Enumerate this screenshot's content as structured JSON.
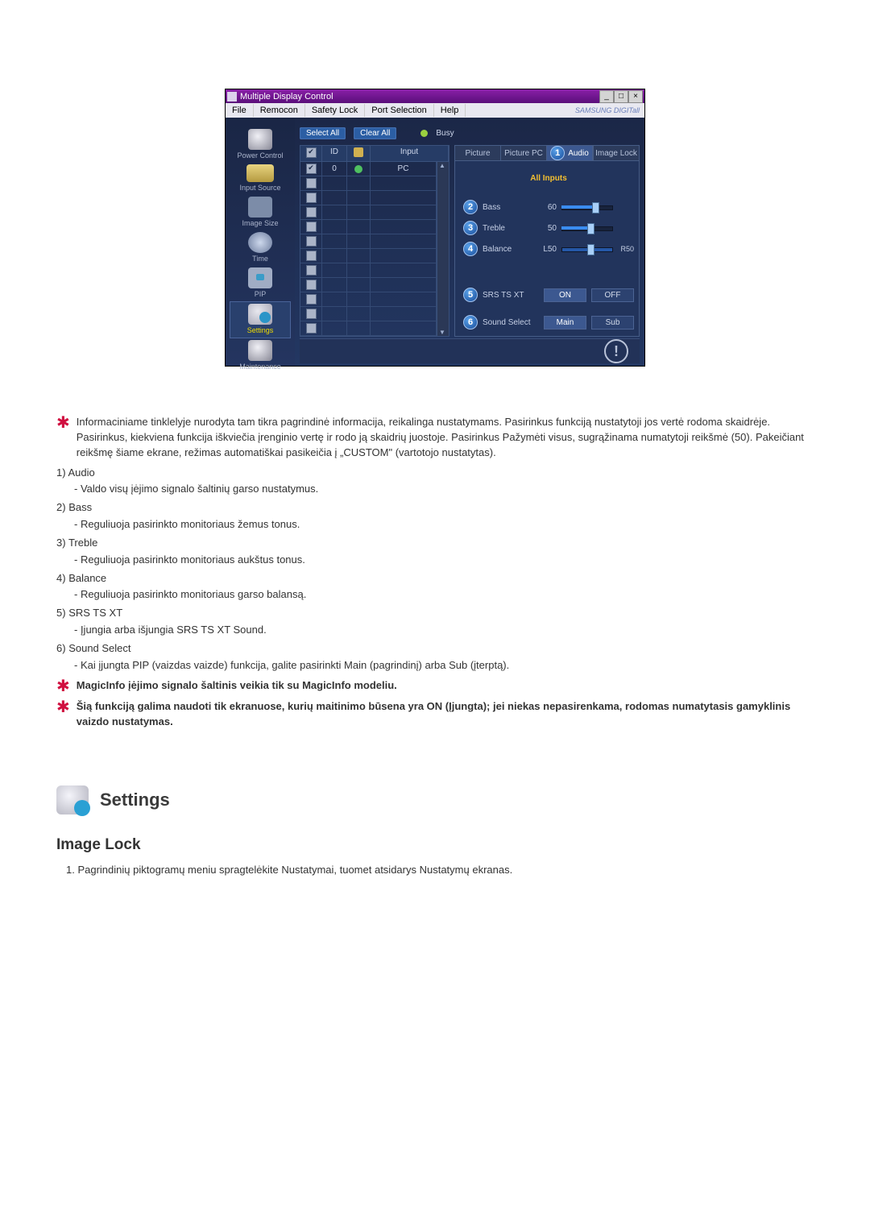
{
  "window": {
    "title": "Multiple Display Control",
    "menu": [
      "File",
      "Remocon",
      "Safety Lock",
      "Port Selection",
      "Help"
    ],
    "brand": "SAMSUNG DIGITall"
  },
  "sidebar": {
    "items": [
      {
        "label": "Power Control"
      },
      {
        "label": "Input Source"
      },
      {
        "label": "Image Size"
      },
      {
        "label": "Time"
      },
      {
        "label": "PIP"
      },
      {
        "label": "Settings"
      },
      {
        "label": "Maintenance"
      }
    ]
  },
  "controls": {
    "select_all": "Select All",
    "clear_all": "Clear All",
    "busy": "Busy"
  },
  "list": {
    "head": {
      "id": "ID",
      "input": "Input"
    },
    "row0": {
      "id": "0",
      "input": "PC"
    }
  },
  "tabs": {
    "picture": "Picture",
    "picture_pc": "Picture PC",
    "audio": "Audio",
    "image_lock": "Image Lock"
  },
  "badges": {
    "b1": "1",
    "b2": "2",
    "b3": "3",
    "b4": "4",
    "b5": "5",
    "b6": "6"
  },
  "panel": {
    "all_inputs": "All Inputs",
    "bass": {
      "label": "Bass",
      "value": "60"
    },
    "treble": {
      "label": "Treble",
      "value": "50"
    },
    "balance": {
      "label": "Balance",
      "value": "L50",
      "right": "R50"
    },
    "srs": {
      "label": "SRS TS XT",
      "on": "ON",
      "off": "OFF"
    },
    "sound_select": {
      "label": "Sound Select",
      "main": "Main",
      "sub": "Sub"
    }
  },
  "doc": {
    "intro": "Informaciniame tinklelyje nurodyta tam tikra pagrindinė informacija, reikalinga nustatymams. Pasirinkus funkciją nustatytoji jos vertė rodoma skaidrėje. Pasirinkus, kiekviena funkcija iškviečia įrenginio vertę ir rodo ją skaidrių juostoje. Pasirinkus Pažymėti visus, sugrąžinama numatytoji reikšmė (50). Pakeičiant reikšmę šiame ekrane, režimas automatiškai pasikeičia į „CUSTOM\" (vartotojo nustatytas).",
    "items": [
      {
        "num": "1)",
        "title": "Audio",
        "sub": "- Valdo visų įėjimo signalo šaltinių garso nustatymus."
      },
      {
        "num": "2)",
        "title": "Bass",
        "sub": "- Reguliuoja pasirinkto monitoriaus žemus tonus."
      },
      {
        "num": "3)",
        "title": "Treble",
        "sub": "- Reguliuoja pasirinkto monitoriaus aukštus tonus."
      },
      {
        "num": "4)",
        "title": "Balance",
        "sub": "- Reguliuoja pasirinkto monitoriaus garso balansą."
      },
      {
        "num": "5)",
        "title": "SRS TS XT",
        "sub": "- Įjungia arba išjungia SRS TS XT Sound."
      },
      {
        "num": "6)",
        "title": "Sound Select",
        "sub": "- Kai įjungta PIP (vaizdas vaizde) funkcija, galite pasirinkti Main (pagrindinį) arba Sub (įterptą)."
      }
    ],
    "note1": "MagicInfo įėjimo signalo šaltinis veikia tik su MagicInfo modeliu.",
    "note2": "Šią funkciją galima naudoti tik ekranuose, kurių maitinimo būsena yra ON (Įjungta); jei niekas nepasirenkama, rodomas numatytasis gamyklinis vaizdo nustatymas.",
    "section_title": "Settings",
    "h3": "Image Lock",
    "ol1": "1.  Pagrindinių piktogramų meniu spragtelėkite Nustatymai, tuomet atsidarys Nustatymų ekranas."
  }
}
